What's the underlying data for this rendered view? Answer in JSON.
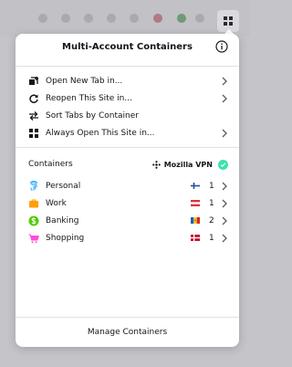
{
  "panel": {
    "title": "Multi-Account Containers",
    "info_icon": "info-icon"
  },
  "menu": [
    {
      "label": "Open New Tab in...",
      "icon": "new-tab-icon",
      "has_submenu": true
    },
    {
      "label": "Reopen This Site in...",
      "icon": "reopen-icon",
      "has_submenu": true
    },
    {
      "label": "Sort Tabs by Container",
      "icon": "sort-icon",
      "has_submenu": false
    },
    {
      "label": "Always Open This Site in...",
      "icon": "grid-icon",
      "has_submenu": true
    }
  ],
  "containers_section": {
    "title": "Containers",
    "vpn_label": "Mozilla VPN",
    "vpn_status_color": "#3fe1b0"
  },
  "containers": [
    {
      "name": "Personal",
      "icon": "fingerprint-icon",
      "color": "#37adff",
      "flag": "finland",
      "count": "1"
    },
    {
      "name": "Work",
      "icon": "briefcase-icon",
      "color": "#ff9f00",
      "flag": "austria",
      "count": "1"
    },
    {
      "name": "Banking",
      "icon": "dollar-icon",
      "color": "#51cd00",
      "flag": "moldova",
      "count": "2"
    },
    {
      "name": "Shopping",
      "icon": "cart-icon",
      "color": "#ff4bda",
      "flag": "denmark",
      "count": "1"
    }
  ],
  "footer": {
    "label": "Manage Containers"
  }
}
